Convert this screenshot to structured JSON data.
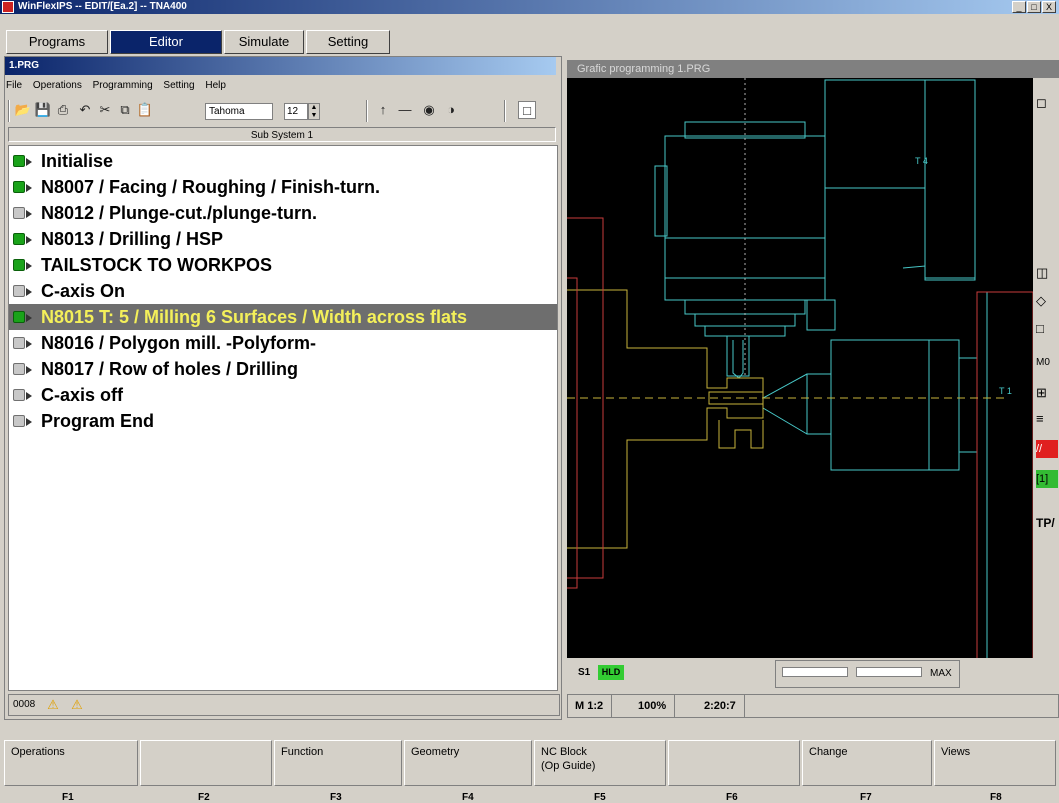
{
  "window": {
    "title": "WinFlexIPS -- EDIT/[Ea.2] -- TNA400",
    "controls": [
      "_",
      "□",
      "X"
    ]
  },
  "main_tabs": [
    {
      "label": "Programs",
      "active": false
    },
    {
      "label": "Editor",
      "active": true
    },
    {
      "label": "Simulate",
      "active": false
    },
    {
      "label": "Setting",
      "active": false
    }
  ],
  "editor": {
    "title": "1.PRG",
    "menu": [
      "File",
      "Operations",
      "Programming",
      "Setting",
      "Help"
    ],
    "font_name": "Tahoma",
    "font_size": "12",
    "subsystem": "Sub System 1",
    "program_lines": [
      {
        "text": "Initialise",
        "icon": "green"
      },
      {
        "text": "N8007 / Facing / Roughing / Finish-turn.",
        "icon": "green"
      },
      {
        "text": "N8012 / Plunge-cut./plunge-turn.",
        "icon": "grey"
      },
      {
        "text": "N8013 / Drilling / HSP",
        "icon": "green"
      },
      {
        "text": "TAILSTOCK TO WORKPOS",
        "icon": "green"
      },
      {
        "text": "C-axis On",
        "icon": "grey"
      },
      {
        "text": "N8015 T: 5 / Milling 6 Surfaces / Width across flats",
        "icon": "green",
        "selected": true
      },
      {
        "text": "N8016 / Polygon mill. -Polyform-",
        "icon": "grey"
      },
      {
        "text": "N8017 / Row of holes / Drilling",
        "icon": "grey"
      },
      {
        "text": "C-axis off",
        "icon": "grey"
      },
      {
        "text": "Program End",
        "icon": "grey"
      }
    ],
    "status_code": "0008"
  },
  "graphics": {
    "title": "Grafic programming   1.PRG",
    "tool_label_top": "T 4",
    "tool_label_right": "T 1",
    "side_label": "M0",
    "side_label2": "TP/",
    "spindle": "S1",
    "spindle_state": "HLD",
    "max_label": "MAX",
    "scale": "M 1:2",
    "zoom": "100%",
    "time": "2:20:7",
    "colors": {
      "workpiece": "#c8b43c",
      "tool": "#48c8c8",
      "chuck": "#c83c3c",
      "background": "#000000"
    }
  },
  "fkeys": [
    {
      "key": "F1",
      "label": "Operations"
    },
    {
      "key": "F2",
      "label": ""
    },
    {
      "key": "F3",
      "label": "Function"
    },
    {
      "key": "F4",
      "label": "Geometry"
    },
    {
      "key": "F5",
      "label": "NC Block\n(Op Guide)"
    },
    {
      "key": "F6",
      "label": ""
    },
    {
      "key": "F7",
      "label": "Change"
    },
    {
      "key": "F8",
      "label": "Views"
    }
  ]
}
